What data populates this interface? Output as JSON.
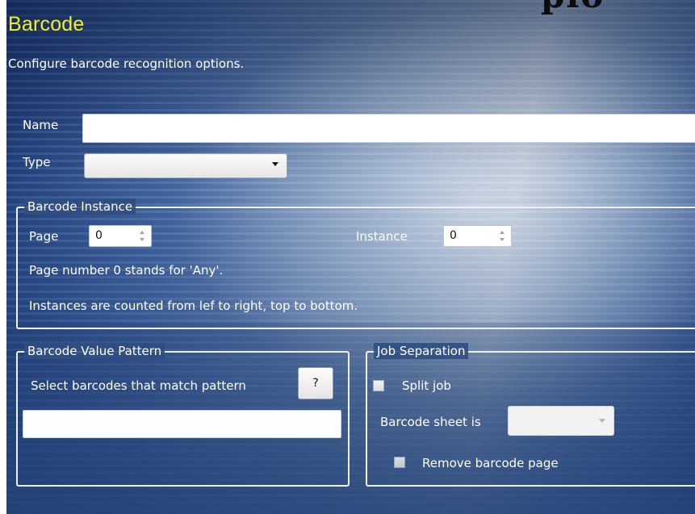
{
  "corner_text": "plo",
  "header": {
    "title": "Barcode",
    "subtitle": "Configure barcode recognition options."
  },
  "form": {
    "name_label": "Name",
    "name_value": "",
    "type_label": "Type",
    "type_value": ""
  },
  "barcode_instance": {
    "legend": "Barcode Instance",
    "page_label": "Page",
    "page_value": "0",
    "instance_label": "Instance",
    "instance_value": "0",
    "note_page": "Page number 0 stands for 'Any'.",
    "note_instance": "Instances are counted from lef to right, top to bottom."
  },
  "value_pattern": {
    "legend": "Barcode Value Pattern",
    "select_label": "Select barcodes that match pattern",
    "help_label": "?",
    "pattern_value": ""
  },
  "job_separation": {
    "legend": "Job Separation",
    "split_job_label": "Split job",
    "split_job_checked": false,
    "barcode_sheet_label": "Barcode sheet is",
    "barcode_sheet_value": "",
    "remove_page_label": "Remove barcode page",
    "remove_page_checked": false
  },
  "icons": {
    "dropdown": "chevron-down-icon",
    "spinner": "spinner-arrows-icon"
  },
  "colors": {
    "title": "#f2ee2a",
    "label_text": "#ffffff",
    "group_border": "#eef2f8"
  }
}
